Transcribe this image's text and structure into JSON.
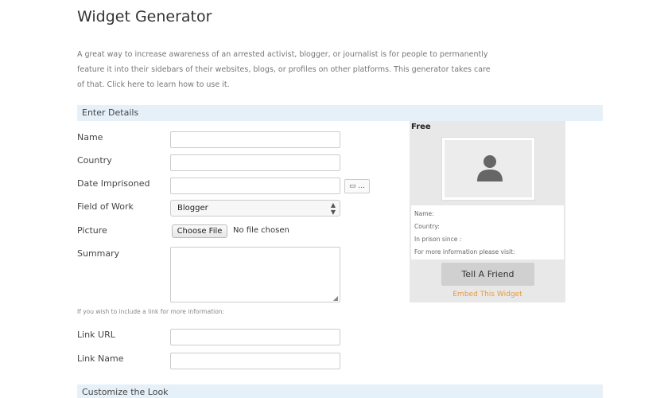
{
  "page": {
    "title": "Widget Generator",
    "intro": "A great way to increase awareness of an arrested activist, blogger, or journalist is for people to permanently feature it into their sidebars of their websites, blogs, or profiles on other platforms. This generator takes care of that. Click here to learn how to use it."
  },
  "sections": {
    "details": "Enter Details",
    "look": "Customize the Look"
  },
  "form": {
    "name_label": "Name",
    "name_value": "",
    "country_label": "Country",
    "country_value": "",
    "date_label": "Date Imprisoned",
    "date_value": "",
    "calendar_button": "▭ ...",
    "field_label": "Field of Work",
    "field_selected": "Blogger",
    "picture_label": "Picture",
    "choose_file": "Choose File",
    "no_file": "No file chosen",
    "summary_label": "Summary",
    "summary_value": "",
    "link_hint": "If you wish to include a link for more information:",
    "link_url_label": "Link URL",
    "link_url_value": "",
    "link_name_label": "Link Name",
    "link_name_value": ""
  },
  "widget": {
    "status": "Free",
    "name_line": "Name:",
    "country_line": "Country:",
    "prison_line": "In prison since :",
    "more_line": "For more information please visit:",
    "tell_friend": "Tell A Friend",
    "embed": "Embed This Widget",
    "accent_color": "#e8983d"
  },
  "icons": {
    "person": "person-silhouette-icon",
    "calendar": "calendar-icon",
    "select_arrows": "updown-arrows-icon",
    "resize": "resize-grip-icon"
  }
}
